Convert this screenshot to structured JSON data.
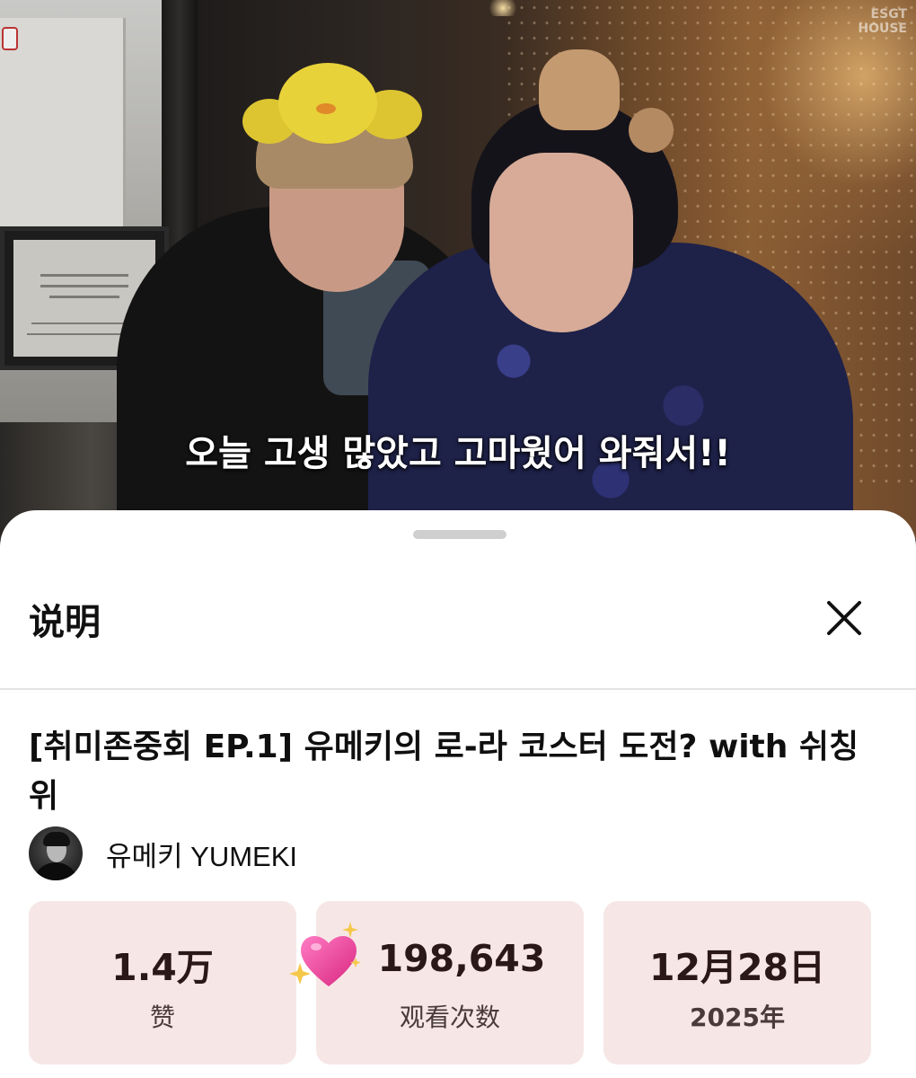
{
  "video": {
    "subtitle": "오늘 고생 많았고 고마웠어 와줘서!!",
    "watermark_line1": "ESGT",
    "watermark_line2": "HOUSE"
  },
  "sheet": {
    "title": "说明",
    "close_icon": "close-icon"
  },
  "description": {
    "video_title": "[취미존중회 EP.1] 유메키의 로-라 코스터 도전? with 쉬칭위",
    "channel_name": "유메키 YUMEKI"
  },
  "stats": [
    {
      "value": "1.4万",
      "label": "赞"
    },
    {
      "value": "198,643",
      "label": "观看次数"
    },
    {
      "value": "12月28日",
      "label": "2025年"
    }
  ],
  "colors": {
    "stat_card_bg": "#f6e7e6",
    "heart_pink": "#e8439a",
    "sparkle_yellow": "#f6c84a"
  }
}
